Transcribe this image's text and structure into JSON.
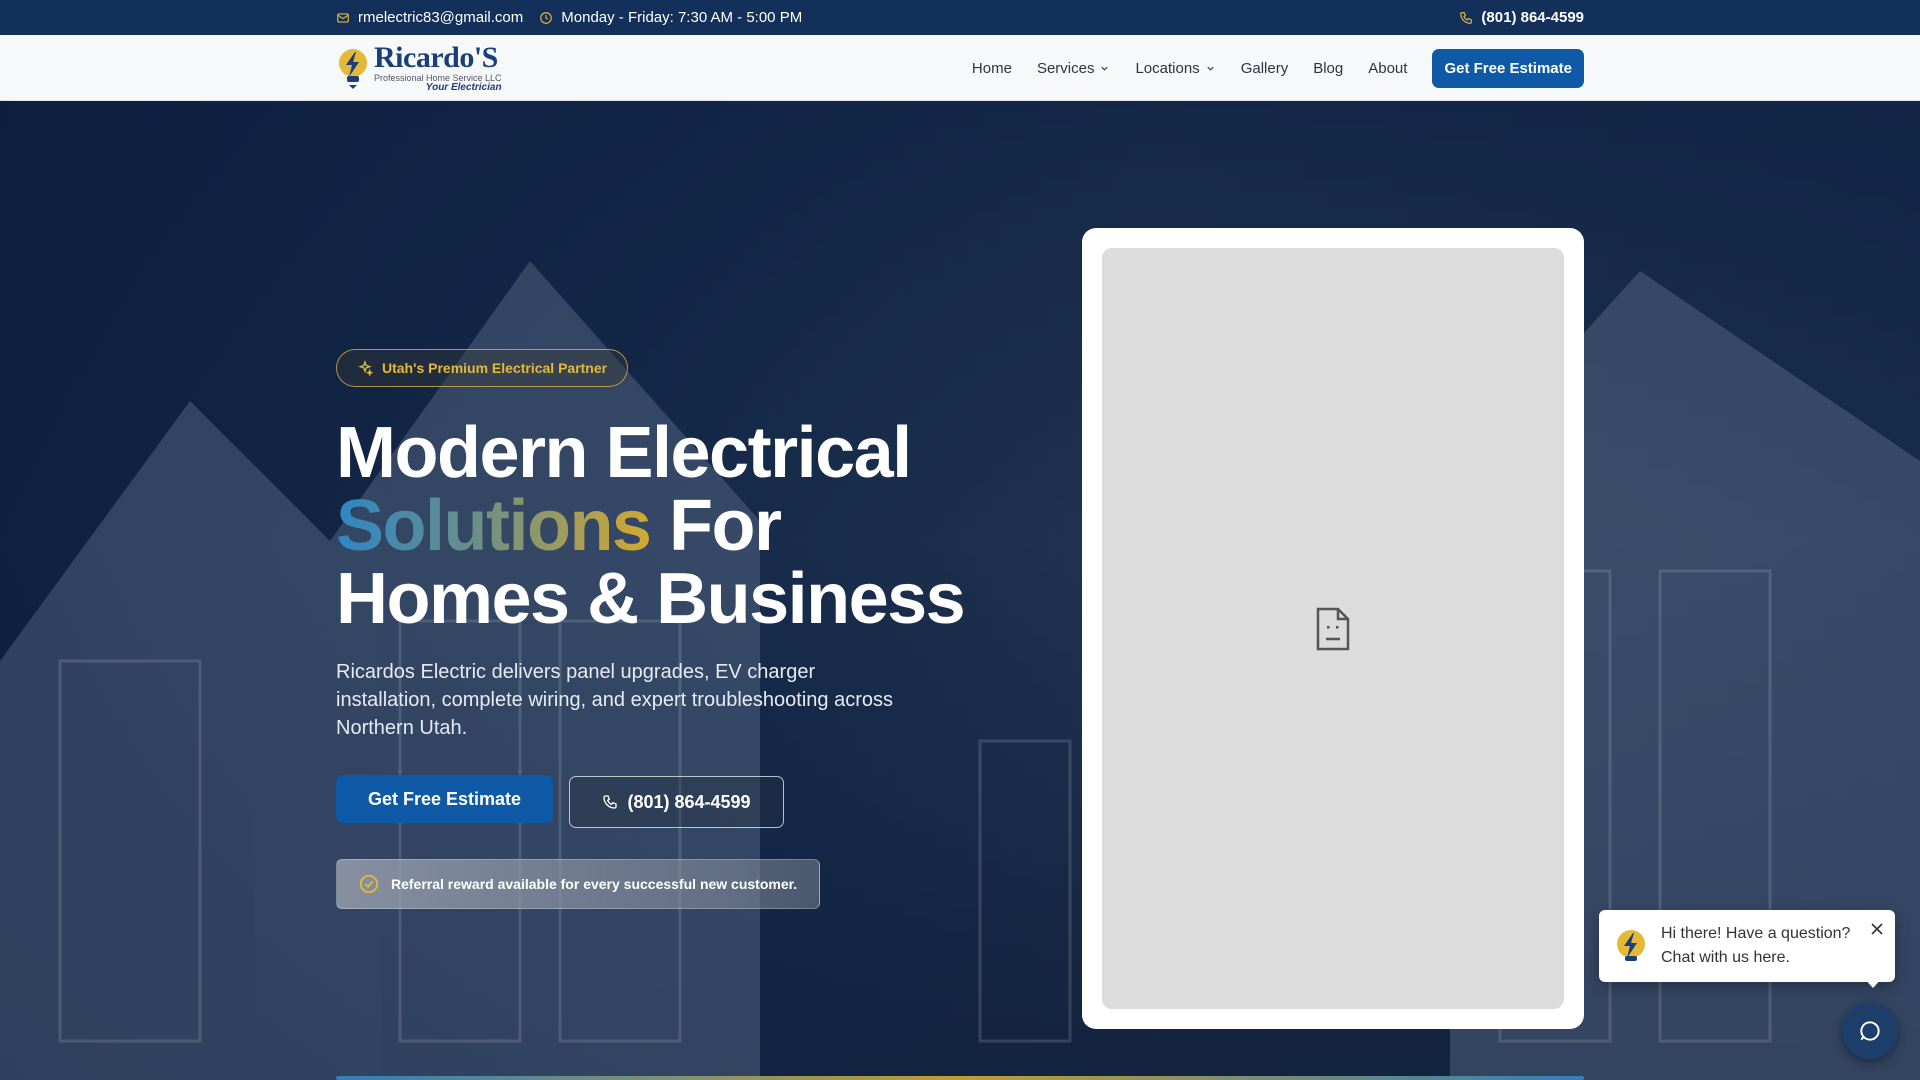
{
  "topbar": {
    "email": "rmelectric83@gmail.com",
    "hours": "Monday - Friday: 7:30 AM - 5:00 PM",
    "phone": "(801) 864-4599"
  },
  "nav": {
    "logo": {
      "name": "Ricardo'S",
      "sub": "Professional Home Service LLC",
      "tagline": "Your Electrician"
    },
    "items": [
      {
        "label": "Home"
      },
      {
        "label": "Services"
      },
      {
        "label": "Locations"
      },
      {
        "label": "Gallery"
      },
      {
        "label": "Blog"
      },
      {
        "label": "About"
      }
    ],
    "cta": "Get Free Estimate"
  },
  "hero": {
    "badge": "Utah's Premium Electrical Partner",
    "headline": {
      "line1": "Modern Electrical",
      "highlight": "Solutions",
      "line2_rest": " For",
      "line3": "Homes & Business"
    },
    "subtext": "Ricardos Electric delivers panel upgrades, EV charger installation, complete wiring, and expert troubleshooting across Northern Utah.",
    "primary_button": "Get Free Estimate",
    "phone_button": "(801) 864-4599",
    "referral": "Referral reward available for every successful new customer."
  },
  "chat": {
    "message": "Hi there! Have a question? Chat with us here."
  },
  "colors": {
    "primary": "#0e5aa7",
    "accent": "#e4b93a",
    "topbar": "#13305a"
  },
  "icons": {
    "email": "mail-icon",
    "hours": "clock-icon",
    "phone": "phone-icon",
    "badge": "sparkle-icon",
    "referral": "check-badge-icon",
    "broken_image": "broken-image-icon",
    "chat": "chat-icon",
    "close": "close-icon"
  }
}
